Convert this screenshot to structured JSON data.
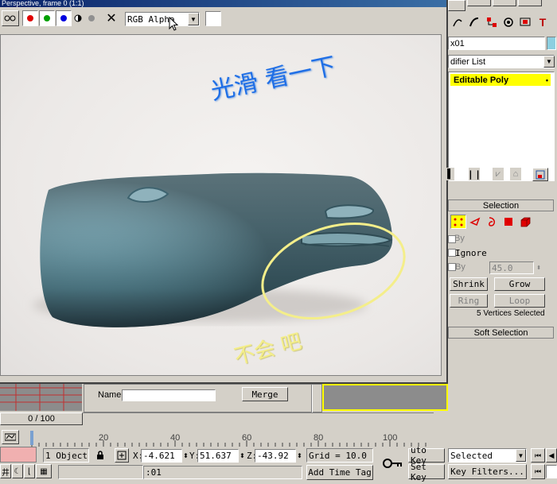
{
  "render_window": {
    "title": "Perspective, frame 0 (1:1)",
    "channel_dropdown": "RGB Alpha",
    "annotations": {
      "smooth_note": "光滑 看一下",
      "bad_note": "不会 吧"
    }
  },
  "command_panel": {
    "object_name": "x01",
    "modifier_list_label": "difier List",
    "stack_item": "Editable Poly",
    "selection_rollout": {
      "title": "Selection",
      "by_vertex_label": "By",
      "ignore_label": "Ignore",
      "by_angle_label": "By",
      "angle_value": "45.0",
      "shrink_label": "Shrink",
      "grow_label": "Grow",
      "ring_label": "Ring",
      "loop_label": "Loop",
      "status_text": "5 Vertices Selected"
    },
    "soft_selection_title": "Soft Selection"
  },
  "merge_dialog": {
    "name_label": "Name:",
    "name_value": "",
    "merge_label": "Merge"
  },
  "timeline": {
    "frame_counter": "0 / 100",
    "ticks": [
      "20",
      "40",
      "60",
      "80",
      "100"
    ]
  },
  "status_bar": {
    "selection_count": "1 Object",
    "x_label": "X:",
    "x_value": "-4.621",
    "y_label": "Y:",
    "y_value": "51.637",
    "z_label": "Z:",
    "z_value": "-43.92",
    "grid_text": "Grid = 10.0",
    "add_time_tag": "Add Time Tag",
    "auto_key": "uto Key",
    "set_key": "Set Key",
    "selected_dropdown": "Selected",
    "key_filters": "Key Filters...",
    "time_readout": ":01"
  },
  "colors": {
    "render_bg": "#ece9e7",
    "model": "#6f9aa6",
    "annotation_blue": "#1e6ee6",
    "annotation_yellow": "#f4ee8a",
    "stack_highlight": "#ffff00"
  }
}
